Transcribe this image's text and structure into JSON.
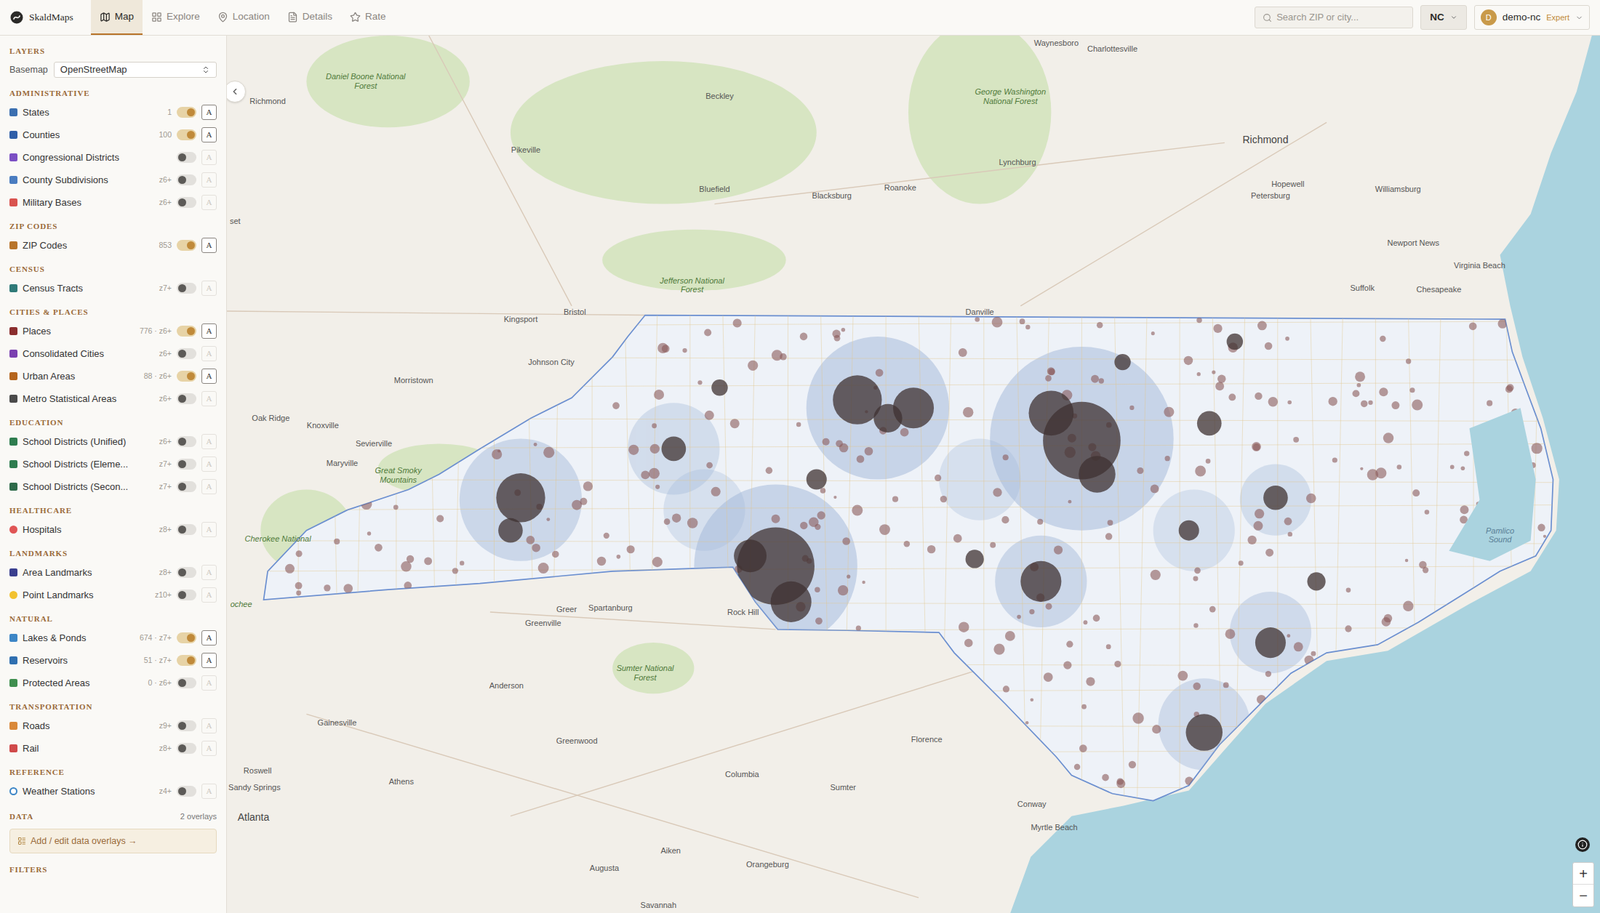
{
  "app": {
    "name": "SkaldMaps"
  },
  "nav": [
    {
      "label": "Map",
      "selected": true
    },
    {
      "label": "Explore",
      "selected": false
    },
    {
      "label": "Location",
      "selected": false
    },
    {
      "label": "Details",
      "selected": false
    },
    {
      "label": "Rate",
      "selected": false
    }
  ],
  "search": {
    "placeholder": "Search ZIP or city..."
  },
  "state_select": {
    "value": "NC"
  },
  "user": {
    "initial": "D",
    "name": "demo-nc",
    "role": "Expert"
  },
  "sidebar": {
    "heading": "LAYERS",
    "basemap_label": "Basemap",
    "basemap_value": "OpenStreetMap",
    "layer_button": "A",
    "sections": [
      {
        "title": "ADMINISTRATIVE",
        "items": [
          {
            "name": "States",
            "count": "1",
            "color": "#3b6fb0",
            "kind": "square",
            "on": true
          },
          {
            "name": "Counties",
            "count": "100",
            "color": "#2f5fa8",
            "kind": "square",
            "on": true
          },
          {
            "name": "Congressional Districts",
            "color": "#7b4fc4",
            "kind": "square",
            "on": false
          },
          {
            "name": "County Subdivisions",
            "count": "z6+",
            "color": "#4a7cc0",
            "kind": "square",
            "on": false
          },
          {
            "name": "Military Bases",
            "count": "z6+",
            "color": "#d9534f",
            "kind": "square",
            "on": false
          }
        ]
      },
      {
        "title": "ZIP CODES",
        "items": [
          {
            "name": "ZIP Codes",
            "count": "853",
            "color": "#b8742a",
            "kind": "square",
            "on": true
          }
        ]
      },
      {
        "title": "CENSUS",
        "items": [
          {
            "name": "Census Tracts",
            "count": "z7+",
            "color": "#2f7a78",
            "kind": "square",
            "on": false
          }
        ]
      },
      {
        "title": "CITIES & PLACES",
        "items": [
          {
            "name": "Places",
            "count": "776 · z6+",
            "color": "#8b2e2e",
            "kind": "square",
            "on": true
          },
          {
            "name": "Consolidated Cities",
            "count": "z6+",
            "color": "#7a3fb0",
            "kind": "square",
            "on": false
          },
          {
            "name": "Urban Areas",
            "count": "88 · z6+",
            "color": "#b5651d",
            "kind": "square",
            "on": true
          },
          {
            "name": "Metro Statistical Areas",
            "count": "z6+",
            "color": "#4a4a4a",
            "kind": "square",
            "on": false
          }
        ]
      },
      {
        "title": "EDUCATION",
        "items": [
          {
            "name": "School Districts (Unified)",
            "count": "z6+",
            "color": "#2e7d4f",
            "kind": "square",
            "on": false
          },
          {
            "name": "School Districts (Eleme...",
            "count": "z7+",
            "color": "#2e7d4f",
            "kind": "square",
            "on": false
          },
          {
            "name": "School Districts (Secon...",
            "count": "z7+",
            "color": "#2e6b4a",
            "kind": "square",
            "on": false
          }
        ]
      },
      {
        "title": "HEALTHCARE",
        "items": [
          {
            "name": "Hospitals",
            "count": "z8+",
            "color": "#e05555",
            "kind": "dot",
            "on": false
          }
        ]
      },
      {
        "title": "LANDMARKS",
        "items": [
          {
            "name": "Area Landmarks",
            "count": "z8+",
            "color": "#3a3f8f",
            "kind": "square",
            "on": false
          },
          {
            "name": "Point Landmarks",
            "count": "z10+",
            "color": "#f2c230",
            "kind": "dot",
            "on": false
          }
        ]
      },
      {
        "title": "NATURAL",
        "items": [
          {
            "name": "Lakes & Ponds",
            "count": "674 · z7+",
            "color": "#3d86c6",
            "kind": "square",
            "on": true
          },
          {
            "name": "Reservoirs",
            "count": "51 · z7+",
            "color": "#2f6fb0",
            "kind": "square",
            "on": true
          },
          {
            "name": "Protected Areas",
            "count": "0 · z6+",
            "color": "#3f8f4f",
            "kind": "square",
            "on": false
          }
        ]
      },
      {
        "title": "TRANSPORTATION",
        "items": [
          {
            "name": "Roads",
            "count": "z9+",
            "color": "#d9893a",
            "kind": "square",
            "on": false
          },
          {
            "name": "Rail",
            "count": "z8+",
            "color": "#d04a4a",
            "kind": "square",
            "on": false
          }
        ]
      },
      {
        "title": "REFERENCE",
        "items": [
          {
            "name": "Weather Stations",
            "count": "z4+",
            "color": "#3d86c6",
            "kind": "ring",
            "on": false
          }
        ]
      }
    ],
    "data": {
      "heading": "DATA",
      "count": "2 overlays",
      "button": "Add / edit data overlays →"
    },
    "filters_heading": "FILTERS"
  },
  "map": {
    "zoom_in": "+",
    "zoom_out": "−",
    "labels": [
      {
        "text": "Waynesboro",
        "kind": "city"
      },
      {
        "text": "Charlottesville",
        "kind": "city"
      },
      {
        "text": "Richmond",
        "kind": "major"
      },
      {
        "text": "Richmond",
        "kind": "city"
      },
      {
        "text": "Daniel Boone National Forest",
        "kind": "forest"
      },
      {
        "text": "Beckley",
        "kind": "city"
      },
      {
        "text": "George Washington National Forest",
        "kind": "forest"
      },
      {
        "text": "Pikeville",
        "kind": "city"
      },
      {
        "text": "Lynchburg",
        "kind": "city"
      },
      {
        "text": "Hopewell",
        "kind": "city"
      },
      {
        "text": "Bluefield",
        "kind": "city"
      },
      {
        "text": "Blacksburg",
        "kind": "city"
      },
      {
        "text": "Roanoke",
        "kind": "city"
      },
      {
        "text": "Petersburg",
        "kind": "city"
      },
      {
        "text": "Williamsburg",
        "kind": "city"
      },
      {
        "text": "Newport News",
        "kind": "city"
      },
      {
        "text": "Virginia Beach",
        "kind": "city"
      },
      {
        "text": "Suffolk",
        "kind": "city"
      },
      {
        "text": "Chesapeake",
        "kind": "city"
      },
      {
        "text": "Jefferson National Forest",
        "kind": "forest"
      },
      {
        "text": "Danville",
        "kind": "city"
      },
      {
        "text": "Bristol",
        "kind": "city"
      },
      {
        "text": "Kingsport",
        "kind": "city"
      },
      {
        "text": "Johnson City",
        "kind": "city"
      },
      {
        "text": "Morristown",
        "kind": "city"
      },
      {
        "text": "Oak Ridge",
        "kind": "city"
      },
      {
        "text": "Knoxville",
        "kind": "city"
      },
      {
        "text": "Sevierville",
        "kind": "city"
      },
      {
        "text": "Maryville",
        "kind": "city"
      },
      {
        "text": "Great Smoky Mountains",
        "kind": "forest"
      },
      {
        "text": "Cherokee National",
        "kind": "forest"
      },
      {
        "text": "Greer",
        "kind": "city"
      },
      {
        "text": "Spartanburg",
        "kind": "city"
      },
      {
        "text": "Rock Hill",
        "kind": "city"
      },
      {
        "text": "Greenville",
        "kind": "city"
      },
      {
        "text": "Sumter National Forest",
        "kind": "forest"
      },
      {
        "text": "Anderson",
        "kind": "city"
      },
      {
        "text": "Gainesville",
        "kind": "city"
      },
      {
        "text": "Greenwood",
        "kind": "city"
      },
      {
        "text": "Florence",
        "kind": "city"
      },
      {
        "text": "Roswell",
        "kind": "city"
      },
      {
        "text": "Columbia",
        "kind": "city"
      },
      {
        "text": "Sandy Springs",
        "kind": "city"
      },
      {
        "text": "Sumter",
        "kind": "city"
      },
      {
        "text": "Athens",
        "kind": "city"
      },
      {
        "text": "Atlanta",
        "kind": "major"
      },
      {
        "text": "Conway",
        "kind": "city"
      },
      {
        "text": "Myrtle Beach",
        "kind": "city"
      },
      {
        "text": "Aiken",
        "kind": "city"
      },
      {
        "text": "Augusta",
        "kind": "city"
      },
      {
        "text": "Orangeburg",
        "kind": "city"
      },
      {
        "text": "Savannah",
        "kind": "city"
      },
      {
        "text": "Pamlico Sound",
        "kind": "water"
      },
      {
        "text": "ochee",
        "kind": "forest"
      },
      {
        "text": "set",
        "kind": "city"
      }
    ]
  }
}
